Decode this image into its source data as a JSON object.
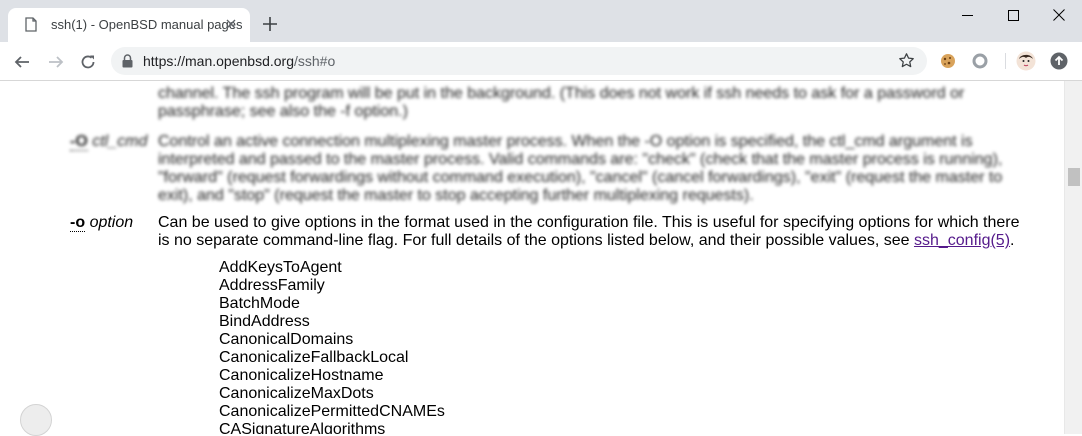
{
  "browser": {
    "tab_title": "ssh(1) - OpenBSD manual pages",
    "url_host": "https://man.openbsd.org",
    "url_path": "/ssh#o"
  },
  "manpage": {
    "prev_text": [
      "channel. The ssh program will be put in the background. (This does not work if ssh needs to ask for a password or",
      "passphrase; see also the -f option.)"
    ],
    "O_flag": "-O",
    "O_arg": "ctl_cmd",
    "O_desc": [
      "Control an active connection multiplexing master process. When the -O option is specified, the ctl_cmd argument is",
      "interpreted and passed to the master process. Valid commands are: \"check\" (check that the master process is running),",
      "\"forward\" (request forwardings without command execution), \"cancel\" (cancel forwardings), \"exit\" (request the master to",
      "exit), and \"stop\" (request the master to stop accepting further multiplexing requests)."
    ],
    "o_flag": "-o",
    "o_arg": "option",
    "o_desc_1": "Can be used to give options in the format used in the configuration file. This is useful for specifying options for which there",
    "o_desc_2": "is no separate command-line flag. For full details of the options listed below, and their possible values, see ",
    "o_link": "ssh_config(5)",
    "o_desc_end": ".",
    "options": [
      "AddKeysToAgent",
      "AddressFamily",
      "BatchMode",
      "BindAddress",
      "CanonicalDomains",
      "CanonicalizeFallbackLocal",
      "CanonicalizeHostname",
      "CanonicalizeMaxDots",
      "CanonicalizePermittedCNAMEs",
      "CASignatureAlgorithms"
    ]
  }
}
